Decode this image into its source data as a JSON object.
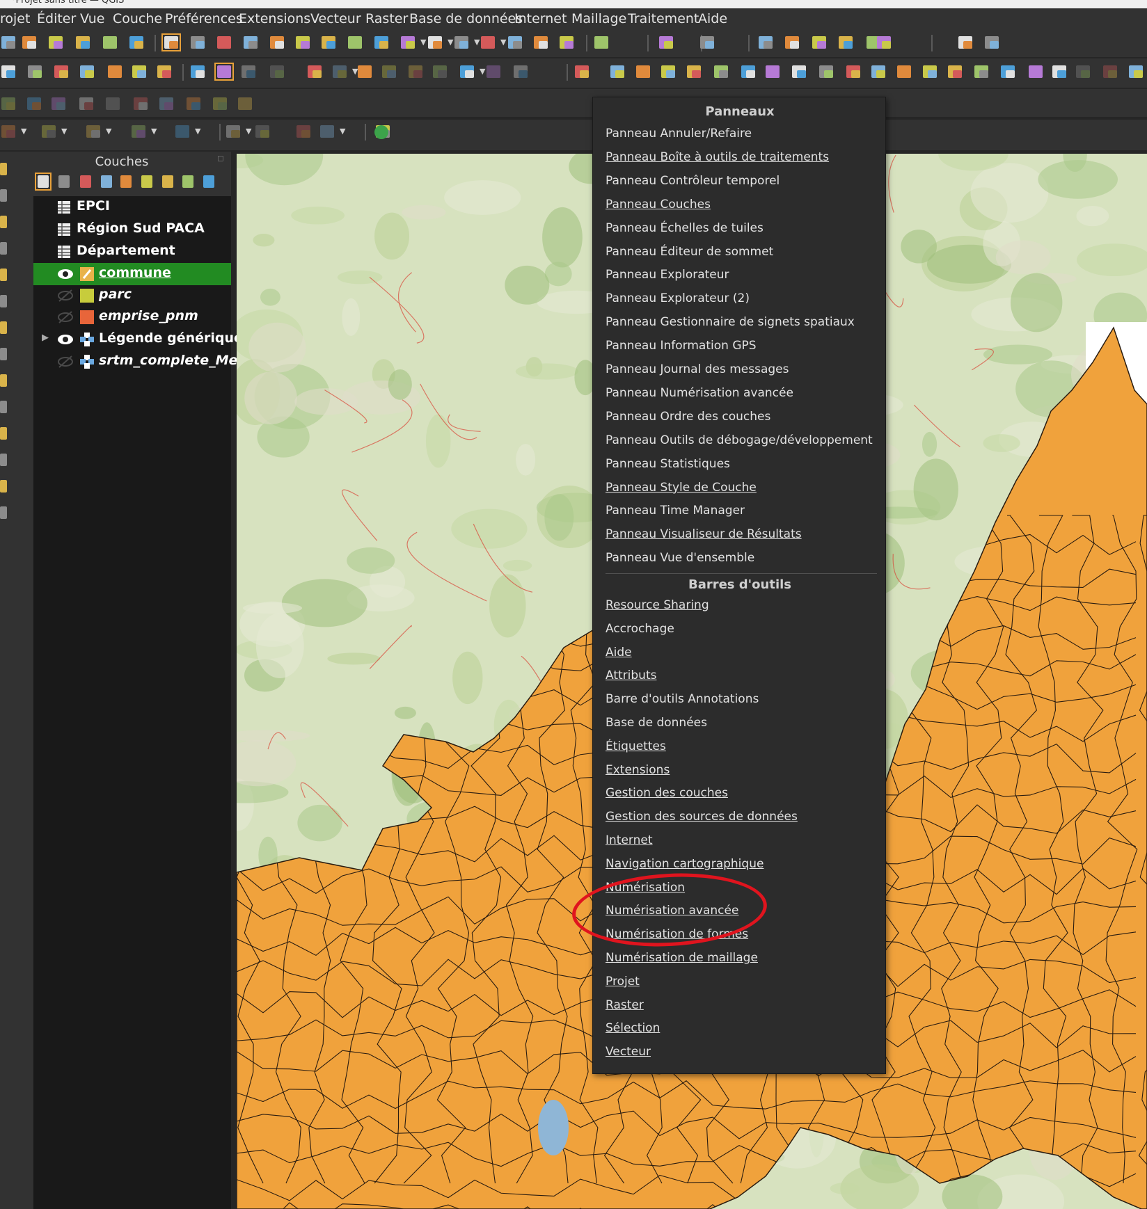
{
  "window": {
    "title": "*Projet sans titre — QGIS"
  },
  "menubar": [
    "rojet",
    "Éditer",
    "Vue",
    "Couche",
    "Préférences",
    "Extensions",
    "Vecteur",
    "Raster",
    "Base de données",
    "Internet",
    "Maillage",
    "Traitement",
    "Aide"
  ],
  "layers_panel": {
    "title": "Couches",
    "layers": [
      {
        "name": "EPCI",
        "style": "bold",
        "visible": false,
        "icon": "table-icon"
      },
      {
        "name": "Région Sud PACA",
        "style": "bold",
        "visible": false,
        "icon": "table-icon"
      },
      {
        "name": "Département",
        "style": "bold",
        "visible": false,
        "icon": "table-icon"
      },
      {
        "name": "commune",
        "style": "bold-underline",
        "visible": true,
        "icon": "edit-pencil-icon",
        "selected": true
      },
      {
        "name": "parc",
        "style": "italic",
        "visible": false,
        "icon": "polygon-swatch",
        "color": "#c7cc3c"
      },
      {
        "name": "emprise_pnm",
        "style": "italic",
        "visible": false,
        "icon": "polygon-swatch",
        "color": "#e8653a"
      },
      {
        "name": "Légende générique",
        "style": "bold",
        "visible": true,
        "icon": "raster-icon",
        "expandable": true
      },
      {
        "name": "srtm_complete_Mer",
        "style": "italic",
        "visible": false,
        "icon": "raster-icon"
      }
    ]
  },
  "context_menu": {
    "panels_header": "Panneaux",
    "panels": [
      {
        "label": "Panneau Annuler/Refaire",
        "checked": false
      },
      {
        "label": "Panneau Boîte à outils de traitements",
        "checked": true
      },
      {
        "label": "Panneau Contrôleur temporel",
        "checked": false
      },
      {
        "label": "Panneau Couches",
        "checked": true
      },
      {
        "label": "Panneau Échelles de tuiles",
        "checked": false
      },
      {
        "label": "Panneau Éditeur de sommet",
        "checked": false
      },
      {
        "label": "Panneau Explorateur",
        "checked": false
      },
      {
        "label": "Panneau Explorateur (2)",
        "checked": false
      },
      {
        "label": "Panneau Gestionnaire de signets spatiaux",
        "checked": false
      },
      {
        "label": "Panneau Information GPS",
        "checked": false
      },
      {
        "label": "Panneau Journal des messages",
        "checked": false
      },
      {
        "label": "Panneau Numérisation avancée",
        "checked": false
      },
      {
        "label": "Panneau Ordre des couches",
        "checked": false
      },
      {
        "label": "Panneau Outils de débogage/développement",
        "checked": false
      },
      {
        "label": "Panneau Statistiques",
        "checked": false
      },
      {
        "label": "Panneau Style de Couche",
        "checked": true
      },
      {
        "label": "Panneau Time Manager",
        "checked": false
      },
      {
        "label": "Panneau Visualiseur de Résultats",
        "checked": true
      },
      {
        "label": "Panneau Vue d'ensemble",
        "checked": false
      }
    ],
    "toolbars_header": "Barres d'outils",
    "toolbars": [
      {
        "label": "Resource Sharing",
        "checked": true
      },
      {
        "label": "Accrochage",
        "checked": false
      },
      {
        "label": "Aide",
        "checked": true
      },
      {
        "label": "Attributs",
        "checked": true
      },
      {
        "label": "Barre d'outils Annotations",
        "checked": false
      },
      {
        "label": "Base de données",
        "checked": false
      },
      {
        "label": "Étiquettes",
        "checked": true
      },
      {
        "label": "Extensions",
        "checked": true
      },
      {
        "label": "Gestion des couches",
        "checked": true
      },
      {
        "label": "Gestion des sources de données",
        "checked": true
      },
      {
        "label": "Internet",
        "checked": true
      },
      {
        "label": "Navigation cartographique",
        "checked": true
      },
      {
        "label": "Numérisation",
        "checked": true
      },
      {
        "label": "Numérisation avancée",
        "checked": true
      },
      {
        "label": "Numérisation de formes",
        "checked": true
      },
      {
        "label": "Numérisation de maillage",
        "checked": true
      },
      {
        "label": "Projet",
        "checked": true
      },
      {
        "label": "Raster",
        "checked": true
      },
      {
        "label": "Sélection",
        "checked": true
      },
      {
        "label": "Vecteur",
        "checked": true
      }
    ]
  },
  "colors": {
    "commune_fill": "#f0a23c",
    "commune_stroke": "#2a1c10",
    "selected_layer": "#228b22",
    "annotation_circle": "#e0141e"
  }
}
